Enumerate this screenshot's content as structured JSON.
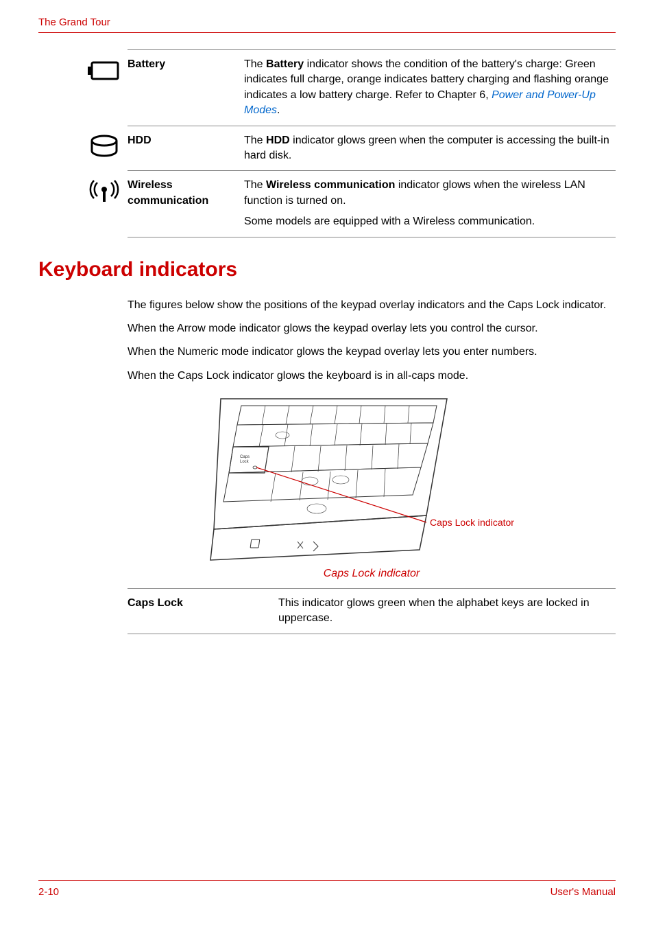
{
  "header": {
    "title": "The Grand Tour"
  },
  "indicators": {
    "rows": [
      {
        "term": "Battery",
        "desc_pre": "The ",
        "desc_bold": "Battery",
        "desc_mid": " indicator shows the condition of the battery's charge: Green indicates full charge, orange indicates battery charging and flashing orange indicates a low battery charge. Refer to Chapter 6, ",
        "link": "Power and Power-Up Modes",
        "desc_post": "."
      },
      {
        "term": "HDD",
        "desc_pre": "The ",
        "desc_bold": "HDD",
        "desc_post": " indicator glows green when the computer is accessing the built-in hard disk."
      },
      {
        "term": "Wireless communication",
        "desc_pre": "The ",
        "desc_bold": "Wireless communication",
        "desc_post": " indicator glows when the wireless LAN function is turned on.",
        "desc_extra": "Some models are equipped with a Wireless communication."
      }
    ]
  },
  "section": {
    "heading": "Keyboard indicators",
    "paras": [
      "The figures below show the positions of the keypad overlay indicators and the Caps Lock indicator.",
      "When the Arrow mode indicator glows the keypad overlay lets you control the cursor.",
      "When the Numeric mode indicator glows the keypad overlay lets you enter numbers.",
      "When the Caps Lock indicator glows the keyboard is in all-caps mode."
    ]
  },
  "figure": {
    "label": "Caps Lock indicator",
    "caption": "Caps Lock indicator"
  },
  "table2": {
    "term": "Caps Lock",
    "desc": "This indicator glows green when the alphabet keys are locked in uppercase."
  },
  "footer": {
    "page": "2-10",
    "doc": "User's Manual"
  }
}
